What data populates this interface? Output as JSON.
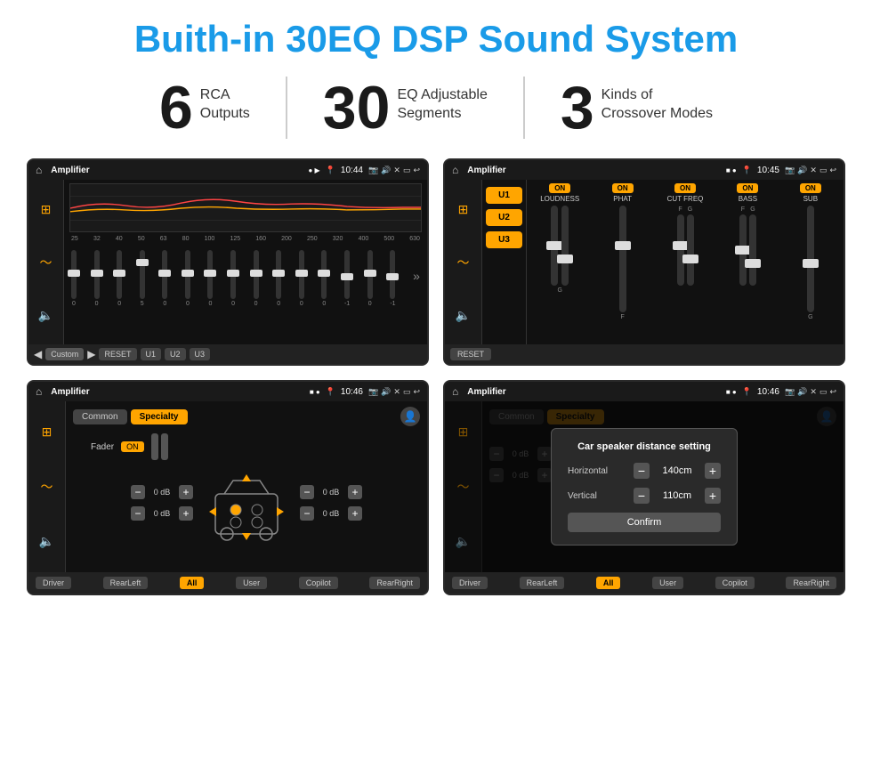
{
  "title": "Buith-in 30EQ DSP Sound System",
  "stats": [
    {
      "number": "6",
      "label_line1": "RCA",
      "label_line2": "Outputs"
    },
    {
      "number": "30",
      "label_line1": "EQ Adjustable",
      "label_line2": "Segments"
    },
    {
      "number": "3",
      "label_line1": "Kinds of",
      "label_line2": "Crossover Modes"
    }
  ],
  "screens": {
    "eq": {
      "status_bar": {
        "app": "Amplifier",
        "time": "10:44"
      },
      "freq_labels": [
        "25",
        "32",
        "40",
        "50",
        "63",
        "80",
        "100",
        "125",
        "160",
        "200",
        "250",
        "320",
        "400",
        "500",
        "630"
      ],
      "slider_values": [
        "0",
        "0",
        "0",
        "5",
        "0",
        "0",
        "0",
        "0",
        "0",
        "0",
        "0",
        "0",
        "-1",
        "0",
        "-1"
      ],
      "buttons": [
        "Custom",
        "RESET",
        "U1",
        "U2",
        "U3"
      ]
    },
    "amplifier": {
      "status_bar": {
        "app": "Amplifier",
        "time": "10:45"
      },
      "presets": [
        "U1",
        "U2",
        "U3"
      ],
      "channels": [
        {
          "label": "LOUDNESS",
          "on": true
        },
        {
          "label": "PHAT",
          "on": true
        },
        {
          "label": "CUT FREQ",
          "on": true
        },
        {
          "label": "BASS",
          "on": true
        },
        {
          "label": "SUB",
          "on": true
        }
      ],
      "reset_label": "RESET"
    },
    "crossover": {
      "status_bar": {
        "app": "Amplifier",
        "time": "10:46"
      },
      "tabs": [
        "Common",
        "Specialty"
      ],
      "fader_label": "Fader",
      "fader_on": true,
      "volumes": [
        "0 dB",
        "0 dB",
        "0 dB",
        "0 dB"
      ],
      "bottom_buttons": [
        "Driver",
        "RearLeft",
        "All",
        "User",
        "Copilot",
        "RearRight"
      ]
    },
    "distance": {
      "status_bar": {
        "app": "Amplifier",
        "time": "10:46"
      },
      "tabs": [
        "Common",
        "Specialty"
      ],
      "dialog": {
        "title": "Car speaker distance setting",
        "horizontal_label": "Horizontal",
        "horizontal_value": "140cm",
        "vertical_label": "Vertical",
        "vertical_value": "110cm",
        "confirm_label": "Confirm"
      },
      "bottom_buttons": [
        "Driver",
        "RearLeft",
        "All",
        "User",
        "Copilot",
        "RearRight"
      ]
    }
  }
}
